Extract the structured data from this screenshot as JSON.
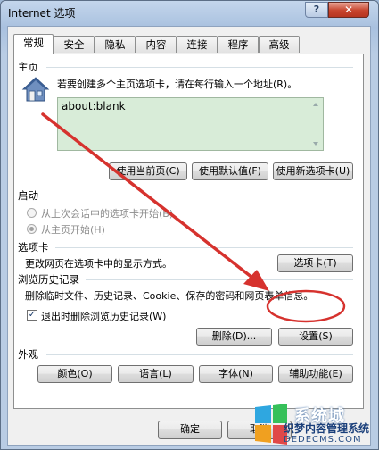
{
  "window": {
    "title": "Internet 选项",
    "help_label": "?",
    "close_label": "✕"
  },
  "tabs": [
    {
      "label": "常规",
      "active": true
    },
    {
      "label": "安全"
    },
    {
      "label": "隐私"
    },
    {
      "label": "内容"
    },
    {
      "label": "连接"
    },
    {
      "label": "程序"
    },
    {
      "label": "高级"
    }
  ],
  "homepage": {
    "group_label": "主页",
    "icon": "house-icon",
    "description": "若要创建多个主页选项卡，请在每行输入一个地址(R)。",
    "value": "about:blank",
    "btn_current": "使用当前页(C)",
    "btn_default": "使用默认值(F)",
    "btn_blank": "使用新选项卡(U)"
  },
  "startup": {
    "group_label": "启动",
    "option1": "从上次会话中的选项卡开始(B)",
    "option2": "从主页开始(H)",
    "selected": "option2"
  },
  "tabs_section": {
    "group_label": "选项卡",
    "description": "更改网页在选项卡中的显示方式。",
    "btn": "选项卡(T)"
  },
  "history": {
    "group_label": "浏览历史记录",
    "description": "删除临时文件、历史记录、Cookie、保存的密码和网页表单信息。",
    "checkbox_label": "退出时删除浏览历史记录(W)",
    "checked": true,
    "btn_delete": "删除(D)...",
    "btn_settings": "设置(S)"
  },
  "appearance": {
    "group_label": "外观",
    "btn_colors": "颜色(O)",
    "btn_languages": "语言(L)",
    "btn_fonts": "字体(N)",
    "btn_accessibility": "辅助功能(E)"
  },
  "footer": {
    "btn_ok": "确定",
    "btn_cancel": "取消"
  },
  "watermark": {
    "line1": "系统城",
    "line2": "织梦内容管理系统",
    "line3": "DEDECMS.COM"
  },
  "colors": {
    "annotation_red": "#d6322e",
    "homepage_bg": "#d8ecd8"
  }
}
